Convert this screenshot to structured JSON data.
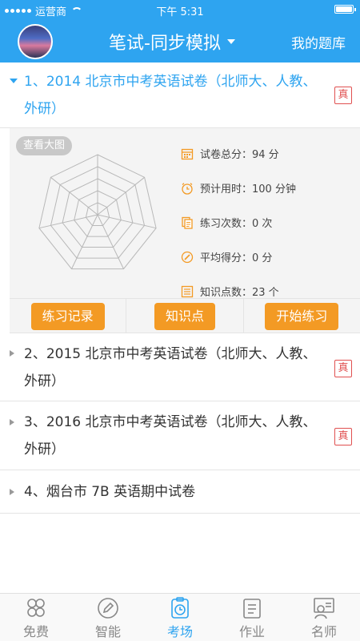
{
  "status_bar": {
    "carrier": "运营商",
    "time": "下午 5:31"
  },
  "header": {
    "title": "笔试-同步模拟",
    "right_link": "我的题库"
  },
  "papers": [
    {
      "label": "1、2014 北京市中考英语试卷（北师大、人教、外研）",
      "badge": "真",
      "expanded": true
    },
    {
      "label": "2、2015 北京市中考英语试卷（北师大、人教、外研）",
      "badge": "真",
      "expanded": false
    },
    {
      "label": "3、2016 北京市中考英语试卷（北师大、人教、外研）",
      "badge": "真",
      "expanded": false
    },
    {
      "label": "4、烟台市 7B 英语期中试卷",
      "badge": "",
      "expanded": false
    }
  ],
  "detail": {
    "view_big": "查看大图",
    "stats": [
      {
        "label": "试卷总分：94 分",
        "icon": "calendar-icon"
      },
      {
        "label": "预计用时：100 分钟",
        "icon": "alarm-clock-icon"
      },
      {
        "label": "练习次数：0 次",
        "icon": "documents-icon"
      },
      {
        "label": "平均得分：0 分",
        "icon": "pencil-circle-icon"
      },
      {
        "label": "知识点数：23 个",
        "icon": "list-icon"
      }
    ],
    "buttons": {
      "record": "练习记录",
      "knowledge": "知识点",
      "start": "开始练习"
    }
  },
  "tabs": [
    {
      "label": "免费",
      "icon": "clover-icon",
      "active": false
    },
    {
      "label": "智能",
      "icon": "pen-circle-icon",
      "active": false
    },
    {
      "label": "考场",
      "icon": "exam-clock-icon",
      "active": true
    },
    {
      "label": "作业",
      "icon": "clipboard-icon",
      "active": false
    },
    {
      "label": "名师",
      "icon": "teacher-icon",
      "active": false
    }
  ],
  "colors": {
    "primary": "#2ea4f0",
    "button": "#f39a24",
    "badge": "#e05050"
  }
}
